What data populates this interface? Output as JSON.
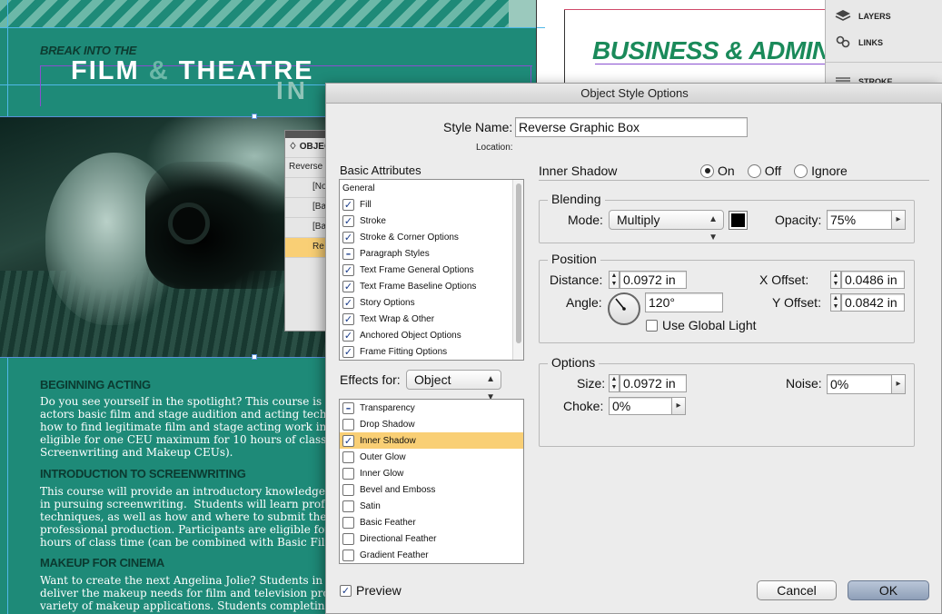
{
  "document": {
    "left_heading_small": "BREAK INTO THE",
    "left_heading_large_1": "FILM",
    "left_heading_amp": "&",
    "left_heading_large_2": "THEATRE",
    "left_heading_partial": "IN",
    "right_heading": "BUSINESS & ADMIN",
    "mini_panel": {
      "header": "♢ OBJECT",
      "rows": [
        "Reverse G",
        "[No",
        "[Ba",
        "[Ba",
        "Re"
      ]
    },
    "sections": [
      {
        "heading": "BEGINNING ACTING",
        "body": "Do you see yourself in the spotlight? This course is d\nactors basic film and stage audition and acting techn\nhow to find legitimate film and stage acting work in l\neligible for one CEU maximum for 10 hours of class ti\nScreenwriting and Makeup CEUs)."
      },
      {
        "heading": "INTRODUCTION TO SCREENWRITING",
        "body": "This course will provide an introductory knowledge h\nin pursuing screenwriting.  Students will learn profes\ntechniques, as well as how and where to submit their\nprofessional production. Participants are eligible for\nhours of class time (can be combined with Basic Film"
      },
      {
        "heading": "MAKEUP FOR CINEMA",
        "body": "Want to create the next Angelina Jolie? Students in t\ndeliver the makeup needs for film and television proc\nvariety of makeup applications. Students completing"
      }
    ]
  },
  "right_panel": {
    "items": [
      {
        "label": "LAYERS",
        "icon": "layers-icon"
      },
      {
        "label": "LINKS",
        "icon": "links-icon"
      },
      {
        "label": "STROKE",
        "icon": "stroke-icon"
      }
    ]
  },
  "dialog": {
    "title": "Object Style Options",
    "style_name_label": "Style Name:",
    "style_name_value": "Reverse Graphic Box",
    "location_label": "Location:",
    "basic_attributes_label": "Basic Attributes",
    "basic_attributes": [
      {
        "label": "General",
        "check": "none"
      },
      {
        "label": "Fill",
        "check": "checked"
      },
      {
        "label": "Stroke",
        "check": "checked"
      },
      {
        "label": "Stroke & Corner Options",
        "check": "checked"
      },
      {
        "label": "Paragraph Styles",
        "check": "mixed"
      },
      {
        "label": "Text Frame General Options",
        "check": "checked"
      },
      {
        "label": "Text Frame Baseline Options",
        "check": "checked"
      },
      {
        "label": "Story Options",
        "check": "checked"
      },
      {
        "label": "Text Wrap & Other",
        "check": "checked"
      },
      {
        "label": "Anchored Object Options",
        "check": "checked"
      },
      {
        "label": "Frame Fitting Options",
        "check": "checked"
      }
    ],
    "effects_for_label": "Effects for:",
    "effects_for_value": "Object",
    "effects": [
      {
        "label": "Transparency",
        "check": "mixed",
        "selected": false
      },
      {
        "label": "Drop Shadow",
        "check": "unchecked",
        "selected": false
      },
      {
        "label": "Inner Shadow",
        "check": "checked",
        "selected": true
      },
      {
        "label": "Outer Glow",
        "check": "unchecked",
        "selected": false
      },
      {
        "label": "Inner Glow",
        "check": "unchecked",
        "selected": false
      },
      {
        "label": "Bevel and Emboss",
        "check": "unchecked",
        "selected": false
      },
      {
        "label": "Satin",
        "check": "unchecked",
        "selected": false
      },
      {
        "label": "Basic Feather",
        "check": "unchecked",
        "selected": false
      },
      {
        "label": "Directional Feather",
        "check": "unchecked",
        "selected": false
      },
      {
        "label": "Gradient Feather",
        "check": "unchecked",
        "selected": false
      }
    ],
    "preview_label": "Preview",
    "preview_checked": true,
    "inner_shadow": {
      "label": "Inner Shadow",
      "state_options": [
        "On",
        "Off",
        "Ignore"
      ],
      "state_selected": "On",
      "blending": {
        "group_label": "Blending",
        "mode_label": "Mode:",
        "mode_value": "Multiply",
        "color": "#000000",
        "opacity_label": "Opacity:",
        "opacity_value": "75%"
      },
      "position": {
        "group_label": "Position",
        "distance_label": "Distance:",
        "distance_value": "0.0972 in",
        "angle_label": "Angle:",
        "angle_value": "120°",
        "use_global_light_label": "Use Global Light",
        "x_offset_label": "X Offset:",
        "x_offset_value": "0.0486 in",
        "y_offset_label": "Y Offset:",
        "y_offset_value": "0.0842 in"
      },
      "options": {
        "group_label": "Options",
        "size_label": "Size:",
        "size_value": "0.0972 in",
        "noise_label": "Noise:",
        "noise_value": "0%",
        "choke_label": "Choke:",
        "choke_value": "0%"
      }
    },
    "cancel_label": "Cancel",
    "ok_label": "OK"
  },
  "colors": {
    "doc_teal": "#1e8a78",
    "highlight": "#f9cf75",
    "title_green": "#1a8a5a"
  }
}
